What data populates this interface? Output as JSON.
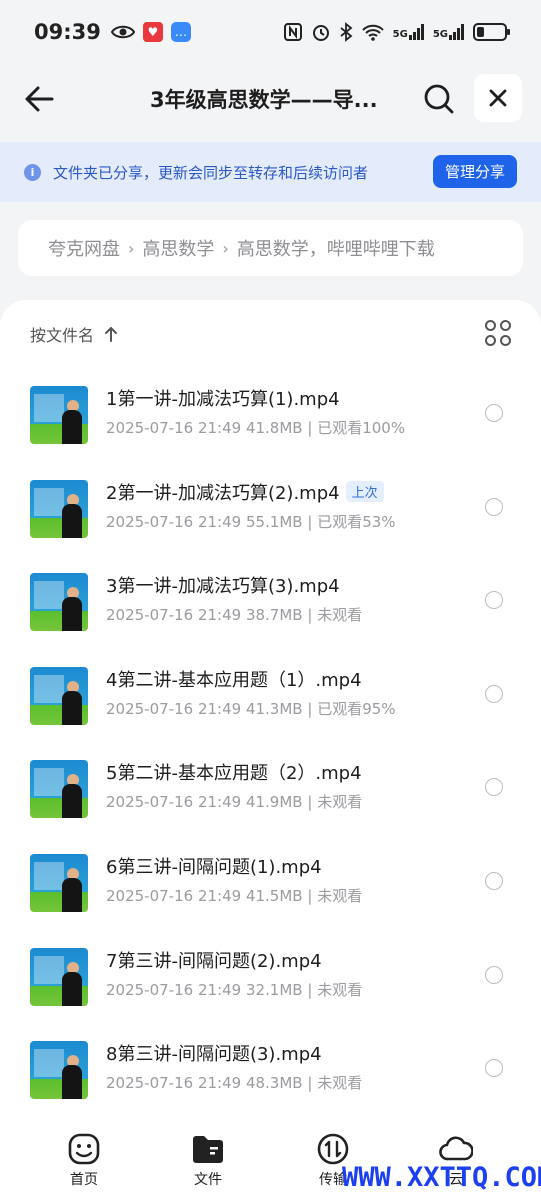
{
  "status_bar": {
    "time": "09:39",
    "signal_1": "5G",
    "signal_2": "5G"
  },
  "header": {
    "title": "3年级高思数学——导..."
  },
  "share_banner": {
    "text": "文件夹已分享，更新会同步至转存和后续访问者",
    "button": "管理分享"
  },
  "breadcrumb": {
    "items": [
      "夸克网盘",
      "高思数学",
      "高思数学，哔哩哔哩下载"
    ]
  },
  "sort": {
    "label": "按文件名"
  },
  "files": [
    {
      "name": "1第一讲-加减法巧算(1).mp4",
      "date": "2025-07-16 21:49",
      "size": "41.8MB",
      "status": "已观看100%"
    },
    {
      "name": "2第一讲-加减法巧算(2).mp4",
      "tag": "上次",
      "date": "2025-07-16 21:49",
      "size": "55.1MB",
      "status": "已观看53%"
    },
    {
      "name": "3第一讲-加减法巧算(3).mp4",
      "date": "2025-07-16 21:49",
      "size": "38.7MB",
      "status": "未观看"
    },
    {
      "name": "4第二讲-基本应用题（1）.mp4",
      "date": "2025-07-16 21:49",
      "size": "41.3MB",
      "status": "已观看95%"
    },
    {
      "name": "5第二讲-基本应用题（2）.mp4",
      "date": "2025-07-16 21:49",
      "size": "41.9MB",
      "status": "未观看"
    },
    {
      "name": "6第三讲-间隔问题(1).mp4",
      "date": "2025-07-16 21:49",
      "size": "41.5MB",
      "status": "未观看"
    },
    {
      "name": "7第三讲-间隔问题(2).mp4",
      "date": "2025-07-16 21:49",
      "size": "32.1MB",
      "status": "未观看"
    },
    {
      "name": "8第三讲-间隔问题(3).mp4",
      "date": "2025-07-16 21:49",
      "size": "48.3MB",
      "status": "未观看"
    }
  ],
  "bottom_nav": {
    "items": [
      "首页",
      "文件",
      "传输",
      "云"
    ]
  },
  "watermark": "WWW.XXTTQ.COM"
}
